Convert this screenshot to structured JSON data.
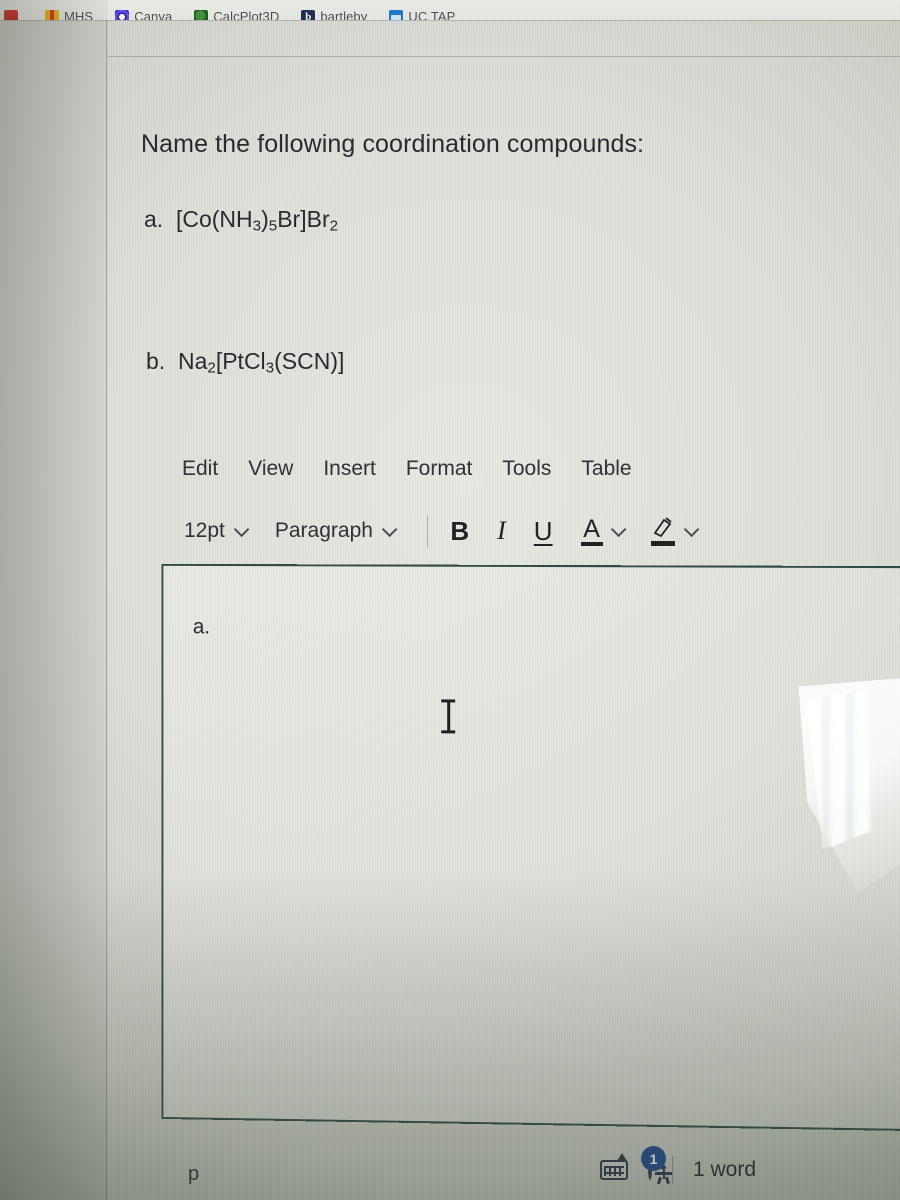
{
  "browser": {
    "bookmarks": [
      {
        "label": "",
        "icon": "red-favicon"
      },
      {
        "label": "MHS",
        "icon": "mhs-favicon"
      },
      {
        "label": "Canva",
        "icon": "canva-favicon"
      },
      {
        "label": "CalcPlot3D",
        "icon": "calcplot3d-favicon"
      },
      {
        "label": "bartleby",
        "icon": "bartleby-favicon"
      },
      {
        "label": "UC TAP",
        "icon": "uctap-favicon"
      }
    ]
  },
  "question": {
    "prompt": "Name the following coordination compounds:",
    "items": [
      {
        "marker": "a.",
        "formula": "[Co(NH3)5Br]Br2"
      },
      {
        "marker": "b.",
        "formula": "Na2[PtCl3(SCN)]"
      }
    ]
  },
  "editor": {
    "menu": [
      "Edit",
      "View",
      "Insert",
      "Format",
      "Tools",
      "Table"
    ],
    "toolbar": {
      "font_size": "12pt",
      "block_format": "Paragraph",
      "bold": "B",
      "italic": "I",
      "underline": "U",
      "text_color": "A",
      "highlight": "highlighter"
    },
    "body_text": "a.",
    "cursor": "i-beam"
  },
  "status": {
    "path": "p",
    "keyboard_icon": "keyboard-resize-icon",
    "accessibility_icon": "accessibility-icon",
    "accessibility_badge": "1",
    "word_count": "1 word"
  },
  "colors": {
    "editor_border": "#2d4a40",
    "badge": "#1b4a8c",
    "text": "#26262a",
    "screen_bg": "#dfe0da"
  }
}
